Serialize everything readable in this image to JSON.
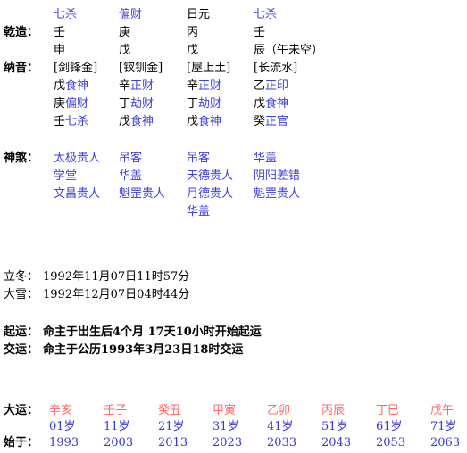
{
  "labels": {
    "gender_pillars": "乾造：",
    "nayin": "纳音：",
    "shensha": "神煞：",
    "dayun": "大运：",
    "shiyu": "始于：",
    "lidong": "立冬：",
    "daxue": "大雪：",
    "qiyun": "起运：",
    "jiaoyun": "交运："
  },
  "pillars": {
    "ten_gods": [
      {
        "text": "七杀",
        "color": "blue"
      },
      {
        "text": "偏财",
        "color": "blue"
      },
      {
        "text": "日元",
        "color": "black"
      },
      {
        "text": "七杀",
        "color": "blue"
      }
    ],
    "heavenly_stems": [
      "壬",
      "庚",
      "丙",
      "壬"
    ],
    "earthly_branches": [
      "申",
      "戊",
      "戊",
      "辰（午未空）"
    ],
    "nayin": [
      "[剑锋金]",
      "[钗钏金]",
      "[屋上土]",
      "[长流水]"
    ],
    "hidden_stems": [
      [
        {
          "stem": "戊",
          "god": "食神"
        },
        {
          "stem": "庚",
          "god": "偏财"
        },
        {
          "stem": "壬",
          "god": "七杀"
        }
      ],
      [
        {
          "stem": "辛",
          "god": "正财"
        },
        {
          "stem": "丁",
          "god": "劫财"
        },
        {
          "stem": "戊",
          "god": "食神"
        }
      ],
      [
        {
          "stem": "辛",
          "god": "正财"
        },
        {
          "stem": "丁",
          "god": "劫财"
        },
        {
          "stem": "戊",
          "god": "食神"
        }
      ],
      [
        {
          "stem": "乙",
          "god": "正印"
        },
        {
          "stem": "戊",
          "god": "食神"
        },
        {
          "stem": "癸",
          "god": "正官"
        }
      ]
    ]
  },
  "shensha": {
    "columns": [
      [
        "太极贵人",
        "学堂",
        "文昌贵人"
      ],
      [
        "吊客",
        "华盖",
        "魁罡贵人"
      ],
      [
        "吊客",
        "天德贵人",
        "月德贵人",
        "华盖"
      ],
      [
        "华盖",
        "阴阳差错",
        "魁罡贵人"
      ]
    ]
  },
  "solar_terms": {
    "lidong_value": "1992年11月07日11时57分",
    "daxue_value": "1992年12月07日04时44分"
  },
  "luck_start": {
    "qiyun_value": "命主于出生后4个月  17天10小时开始起运",
    "jiaoyun_value": "命主于公历1993年3月23日18时交运"
  },
  "dayun": {
    "ganzhi": [
      "辛亥",
      "壬子",
      "癸丑",
      "甲寅",
      "乙卯",
      "丙辰",
      "丁巳",
      "戊午"
    ],
    "ages": [
      "01岁",
      "11岁",
      "21岁",
      "31岁",
      "41岁",
      "51岁",
      "61岁",
      "71岁"
    ],
    "years": [
      "1993",
      "2003",
      "2013",
      "2023",
      "2033",
      "2043",
      "2053",
      "2063"
    ]
  },
  "colors": {
    "blue": "#4040dd",
    "red": "#ff6a6a",
    "black": "#000000",
    "background": "#ffffff"
  }
}
